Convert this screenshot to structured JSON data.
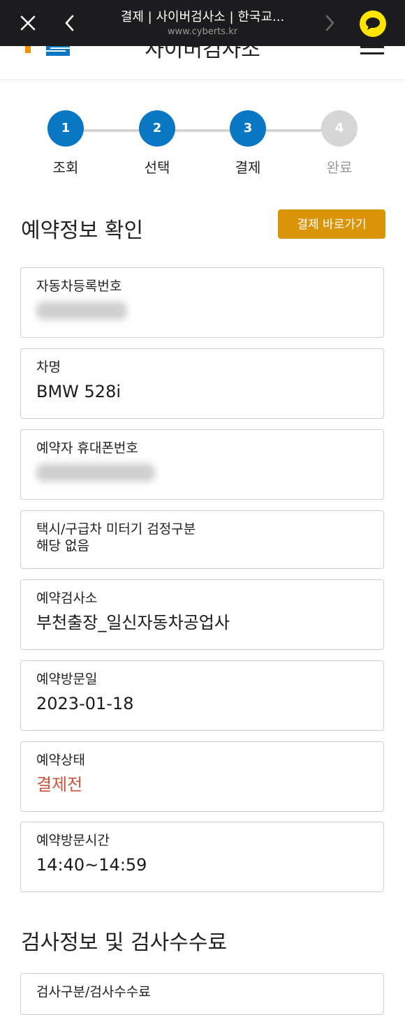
{
  "browser": {
    "title": "결제 | 사이버검사소 | 한국교...",
    "url": "www.cyberts.kr"
  },
  "site": {
    "title": "사이버검사소"
  },
  "stepper": [
    {
      "number": "1",
      "label": "조회",
      "status": "done"
    },
    {
      "number": "2",
      "label": "선택",
      "status": "done"
    },
    {
      "number": "3",
      "label": "결제",
      "status": "current"
    },
    {
      "number": "4",
      "label": "완료",
      "status": "pending"
    }
  ],
  "reservation": {
    "title": "예약정보 확인",
    "pay_button": "결제 바로가기",
    "fields": {
      "car_number": {
        "label": "자동차등록번호"
      },
      "car_name": {
        "label": "차명",
        "value": "BMW 528i"
      },
      "phone": {
        "label": "예약자 휴대폰번호"
      },
      "meter_check": {
        "label": "택시/구급차 미터기 검정구분",
        "value": "해당 없음"
      },
      "center": {
        "label": "예약검사소",
        "value": "부천출장_일신자동차공업사"
      },
      "visit_date": {
        "label": "예약방문일",
        "value": "2023-01-18"
      },
      "status": {
        "label": "예약상태",
        "value": "결제전"
      },
      "visit_time": {
        "label": "예약방문시간",
        "value": "14:40~14:59"
      }
    }
  },
  "inspection": {
    "title": "검사정보 및 검사수수료",
    "first_field_label": "검사구분/검사수수료"
  },
  "colors": {
    "primary": "#0a77c4",
    "accent": "#d99408",
    "status_red": "#d0523a",
    "kakao_yellow": "#fde500"
  }
}
